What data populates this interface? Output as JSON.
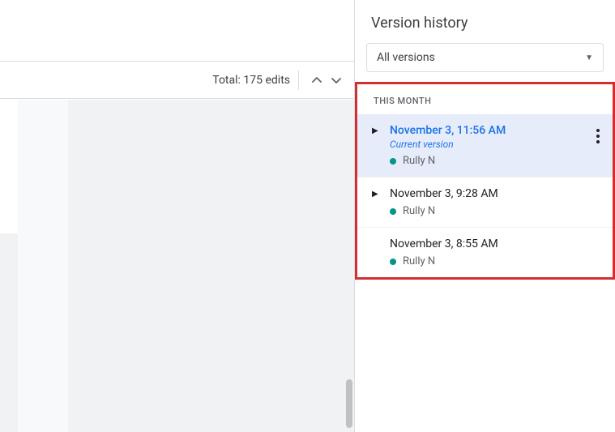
{
  "infobar": {
    "total_edits": "Total: 175 edits"
  },
  "panel": {
    "title": "Version history",
    "filter_selected": "All versions",
    "section_label": "THIS MONTH",
    "versions": [
      {
        "timestamp": "November 3, 11:56 AM",
        "current_label": "Current version",
        "editor": "Rully N"
      },
      {
        "timestamp": "November 3, 9:28 AM",
        "editor": "Rully N"
      },
      {
        "timestamp": "November 3, 8:55 AM",
        "editor": "Rully N"
      }
    ]
  }
}
